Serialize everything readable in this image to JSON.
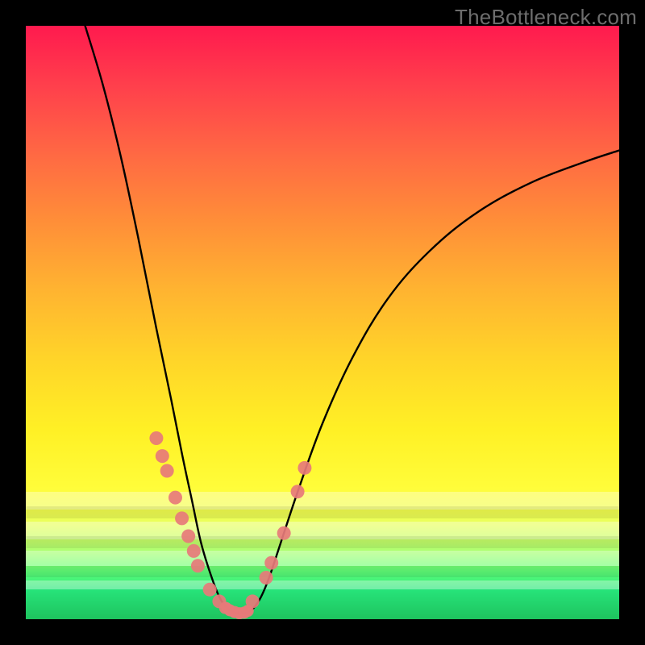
{
  "watermark": {
    "text": "TheBottleneck.com"
  },
  "colors": {
    "frame": "#000000",
    "curve": "#000000",
    "marker_fill": "#e77a7a",
    "marker_stroke": "#c95e5e",
    "band_highlight": "rgba(255,255,255,0.35)",
    "band_shadow": "rgba(0,0,0,0.08)"
  },
  "chart_data": {
    "type": "line",
    "title": "",
    "xlabel": "",
    "ylabel": "",
    "xlim": [
      0,
      100
    ],
    "ylim": [
      0,
      100
    ],
    "curves": {
      "left": [
        [
          10,
          100
        ],
        [
          13,
          90
        ],
        [
          16,
          78
        ],
        [
          19,
          64
        ],
        [
          22,
          49
        ],
        [
          24.5,
          37
        ],
        [
          26.5,
          27
        ],
        [
          28,
          20
        ],
        [
          29.5,
          13
        ],
        [
          31,
          8
        ],
        [
          32.5,
          4
        ],
        [
          33.8,
          2
        ],
        [
          35,
          1.2
        ]
      ],
      "right": [
        [
          35,
          1.2
        ],
        [
          36.5,
          1.0
        ],
        [
          38,
          1.5
        ],
        [
          39.5,
          3.5
        ],
        [
          41,
          7
        ],
        [
          43,
          13
        ],
        [
          46,
          22
        ],
        [
          50,
          33
        ],
        [
          55,
          44
        ],
        [
          61,
          54
        ],
        [
          68,
          62
        ],
        [
          76,
          68.5
        ],
        [
          85,
          73.5
        ],
        [
          94,
          77
        ],
        [
          100,
          79
        ]
      ],
      "trough": [
        [
          33.8,
          2.0
        ],
        [
          34.4,
          1.5
        ],
        [
          35.0,
          1.2
        ],
        [
          35.6,
          1.1
        ],
        [
          36.2,
          1.0
        ],
        [
          36.8,
          1.15
        ],
        [
          37.3,
          1.4
        ]
      ]
    },
    "markers": {
      "left_cluster": [
        [
          22.0,
          30.5
        ],
        [
          23.0,
          27.5
        ],
        [
          23.8,
          25.0
        ],
        [
          25.2,
          20.5
        ],
        [
          26.3,
          17.0
        ],
        [
          27.4,
          14.0
        ],
        [
          28.3,
          11.5
        ],
        [
          29.0,
          9.0
        ],
        [
          31.0,
          5.0
        ],
        [
          32.6,
          3.0
        ]
      ],
      "right_cluster": [
        [
          38.2,
          3.0
        ],
        [
          40.5,
          7.0
        ],
        [
          41.4,
          9.5
        ],
        [
          43.5,
          14.5
        ],
        [
          45.8,
          21.5
        ],
        [
          47.0,
          25.5
        ]
      ],
      "trough_cluster": [
        [
          33.6,
          1.9
        ],
        [
          34.4,
          1.5
        ],
        [
          35.2,
          1.2
        ],
        [
          36.0,
          1.0
        ],
        [
          36.8,
          1.1
        ],
        [
          37.4,
          1.4
        ]
      ]
    }
  }
}
